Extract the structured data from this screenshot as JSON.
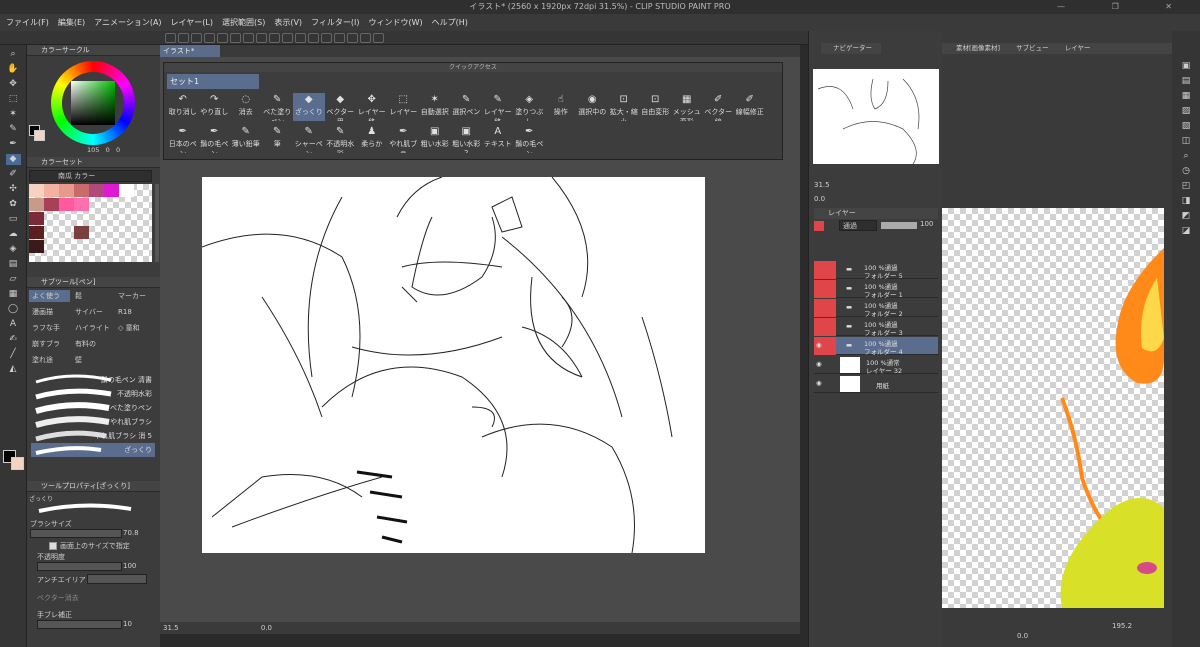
{
  "window": {
    "title": "イラスト* (2560 x 1920px 72dpi 31.5%) - CLIP STUDIO PAINT PRO",
    "controls": "— ❐ ✕"
  },
  "menu": [
    "ファイル(F)",
    "編集(E)",
    "アニメーション(A)",
    "レイヤー(L)",
    "選択範囲(S)",
    "表示(V)",
    "フィルター(I)",
    "ウィンドウ(W)",
    "ヘルプ(H)"
  ],
  "color_wheel": {
    "title": "カラーサークル",
    "values": [
      "105",
      "0",
      "0"
    ]
  },
  "color_set": {
    "title": "カラーセット",
    "set_name": "南瓜 カラー"
  },
  "sub_tool": {
    "title": "サブツール[ペン]",
    "items": [
      "よく使う",
      "鬆",
      "マーカー",
      "漫画描",
      "サイバー",
      "R18",
      "ラフな手",
      "ハイライト",
      "◇ 童和",
      "崩すブラ",
      "有料の",
      "塗れ途",
      "壁"
    ]
  },
  "brushes": [
    "鬚の毛ペン 清書",
    "不透明水彩",
    "べた塗りペン",
    "やれ肌ブラシ",
    "やれ肌ブラシ 消 5",
    "ざっくり"
  ],
  "tool_property": {
    "title": "ツールプロパティ[ざっくり]",
    "brush_label": "ざっくり",
    "brush_size_label": "ブラシサイズ",
    "brush_size_value": "70.8",
    "screen_size_label": "画面上のサイズで指定",
    "opacity_label": "不透明度",
    "opacity_value": "100",
    "aa_label": "アンチエイリアス",
    "vector_erase_label": "ベクター消去",
    "stabilize_label": "手ブレ補正",
    "stabilize_value": "10"
  },
  "doc_tab": "イラスト*",
  "quick_access": {
    "title": "クイックアクセス",
    "set": "セット1",
    "row1": [
      [
        "↶",
        "取り消し"
      ],
      [
        "↷",
        "やり直し"
      ],
      [
        "◌",
        "消去"
      ],
      [
        "✎",
        "べた塗りペン"
      ],
      [
        "◆",
        "ざっくり"
      ],
      [
        "◆",
        "ベクター用"
      ],
      [
        "✥",
        "レイヤー移"
      ],
      [
        "⬚",
        "レイヤー"
      ],
      [
        "✶",
        "自動選択"
      ],
      [
        "✎",
        "選択ペン"
      ],
      [
        "✎",
        "レイヤー移"
      ],
      [
        "◈",
        "塗りつぶし"
      ],
      [
        "☝",
        "操作"
      ],
      [
        "◉",
        "選択中の"
      ],
      [
        "⊡",
        "拡大・縮小"
      ],
      [
        "⊡",
        "自由変形"
      ],
      [
        "▦",
        "メッシュ変形"
      ],
      [
        "✐",
        "ベクター線"
      ],
      [
        "✐",
        "線幅修正"
      ]
    ],
    "row2": [
      [
        "✒",
        "日本のペン"
      ],
      [
        "✒",
        "鬚の毛ペン"
      ],
      [
        "✎",
        "薄い鉛筆"
      ],
      [
        "✎",
        "筆"
      ],
      [
        "✎",
        "シャーペン"
      ],
      [
        "✎",
        "不透明水彩"
      ],
      [
        "♟",
        "柔らか"
      ],
      [
        "✒",
        "やれ肌ブラ"
      ],
      [
        "▣",
        "粗い水彩"
      ],
      [
        "▣",
        "粗い水彩 2"
      ],
      [
        "A",
        "テキスト"
      ],
      [
        "✒",
        "鬚の毛ペン"
      ]
    ]
  },
  "status": {
    "zoom": "31.5",
    "angle": "0.0"
  },
  "navigator": {
    "tab": "ナビゲーター",
    "zoom": "31.5",
    "angle": "0.0"
  },
  "right_tabs": [
    "素材[画像素材]",
    "サブビュー",
    "レイヤー"
  ],
  "layer_panel": {
    "title": "レイヤー",
    "blend": "通過",
    "opacity": "100",
    "layers": [
      {
        "pct": "100 %通過",
        "name": "フォルダー 5"
      },
      {
        "pct": "100 %通過",
        "name": "フォルダー 1"
      },
      {
        "pct": "100 %通過",
        "name": "フォルダー 2"
      },
      {
        "pct": "100 %通過",
        "name": "フォルダー 3"
      },
      {
        "pct": "100 %通過",
        "name": "フォルダー 4"
      },
      {
        "pct": "100 %通常",
        "name": "レイヤー 32"
      },
      {
        "pct": "",
        "name": "用紙"
      }
    ]
  },
  "sub_view": {
    "zoom": "195.2",
    "angle": "0.0"
  },
  "colors": {
    "accent": "#5b6d8e",
    "red_layer": "#e0454a",
    "fire": "#ff8a1a",
    "creature": "#d8e028"
  }
}
